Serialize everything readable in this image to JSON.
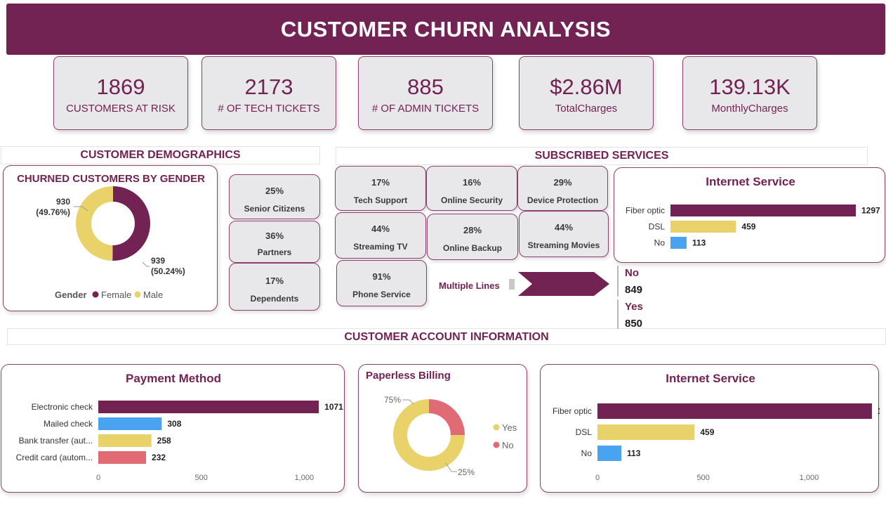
{
  "title": "CUSTOMER CHURN ANALYSIS",
  "kpis": [
    {
      "value": "1869",
      "label": "CUSTOMERS AT RISK"
    },
    {
      "value": "2173",
      "label": "# OF TECH TICKETS"
    },
    {
      "value": "885",
      "label": "# OF ADMIN TICKETS"
    },
    {
      "value": "$2.86M",
      "label": "TotalCharges"
    },
    {
      "value": "139.13K",
      "label": "MonthlyCharges"
    }
  ],
  "sections": {
    "demographics": "CUSTOMER DEMOGRAPHICS",
    "services": "SUBSCRIBED SERVICES",
    "account": "CUSTOMER ACCOUNT INFORMATION"
  },
  "demographic_tiles": [
    {
      "value": "25%",
      "label": "Senior Citizens"
    },
    {
      "value": "36%",
      "label": "Partners"
    },
    {
      "value": "17%",
      "label": "Dependents"
    }
  ],
  "service_tiles": [
    {
      "value": "17%",
      "label": "Tech Support"
    },
    {
      "value": "16%",
      "label": "Online Security"
    },
    {
      "value": "29%",
      "label": "Device Protection"
    },
    {
      "value": "44%",
      "label": "Streaming TV"
    },
    {
      "value": "28%",
      "label": "Online Backup"
    },
    {
      "value": "44%",
      "label": "Streaming Movies"
    },
    {
      "value": "91%",
      "label": "Phone Service"
    }
  ],
  "multiple_lines": {
    "label": "Multiple Lines",
    "no_label": "No",
    "no_value": "849",
    "yes_label": "Yes",
    "yes_value": "850"
  },
  "colors": {
    "primary": "#722253",
    "yellow": "#e9d26a",
    "blue": "#4aa3f0",
    "red": "#e06b75",
    "tile": "#e8e7ea"
  },
  "chart_data": [
    {
      "type": "pie",
      "title": "CHURNED CUSTOMERS BY GENDER",
      "legend_title": "Gender",
      "legend_position": "bottom",
      "slices": [
        {
          "name": "Female",
          "value": 939,
          "label": "939",
          "pct_label": "(50.24%)",
          "color": "#722253"
        },
        {
          "name": "Male",
          "value": 930,
          "label": "930",
          "pct_label": "(49.76%)",
          "color": "#e9d26a"
        }
      ]
    },
    {
      "type": "bar",
      "title": "Internet Service",
      "orientation": "horizontal",
      "categories": [
        "Fiber optic",
        "DSL",
        "No"
      ],
      "values": [
        1297,
        459,
        113
      ],
      "colors": [
        "#722253",
        "#e9d26a",
        "#4aa3f0"
      ],
      "xlim": [
        0,
        1297
      ]
    },
    {
      "type": "bar",
      "title": "Payment Method",
      "orientation": "horizontal",
      "categories": [
        "Electronic check",
        "Mailed check",
        "Bank transfer (aut...",
        "Credit card (autom..."
      ],
      "values": [
        1071,
        308,
        258,
        232
      ],
      "colors": [
        "#722253",
        "#4aa3f0",
        "#e9d26a",
        "#e06b75"
      ],
      "xlim": [
        0,
        1200
      ],
      "xticks": [
        0,
        500,
        1000
      ],
      "xtick_labels": [
        "0",
        "500",
        "1,000"
      ],
      "grid": false
    },
    {
      "type": "pie",
      "title": "Paperless Billing",
      "legend_position": "right",
      "slices": [
        {
          "name": "Yes",
          "value": 75,
          "label": "75%",
          "color": "#e9d26a"
        },
        {
          "name": "No",
          "value": 25,
          "label": "25%",
          "color": "#e06b75"
        }
      ]
    },
    {
      "type": "bar",
      "title": "Internet Service",
      "orientation": "horizontal",
      "categories": [
        "Fiber optic",
        "DSL",
        "No"
      ],
      "values": [
        1297,
        459,
        113
      ],
      "colors": [
        "#722253",
        "#e9d26a",
        "#4aa3f0"
      ],
      "xlim": [
        0,
        1400
      ],
      "xticks": [
        0,
        500,
        1000
      ],
      "xtick_labels": [
        "0",
        "500",
        "1,000"
      ],
      "grid": false
    }
  ]
}
